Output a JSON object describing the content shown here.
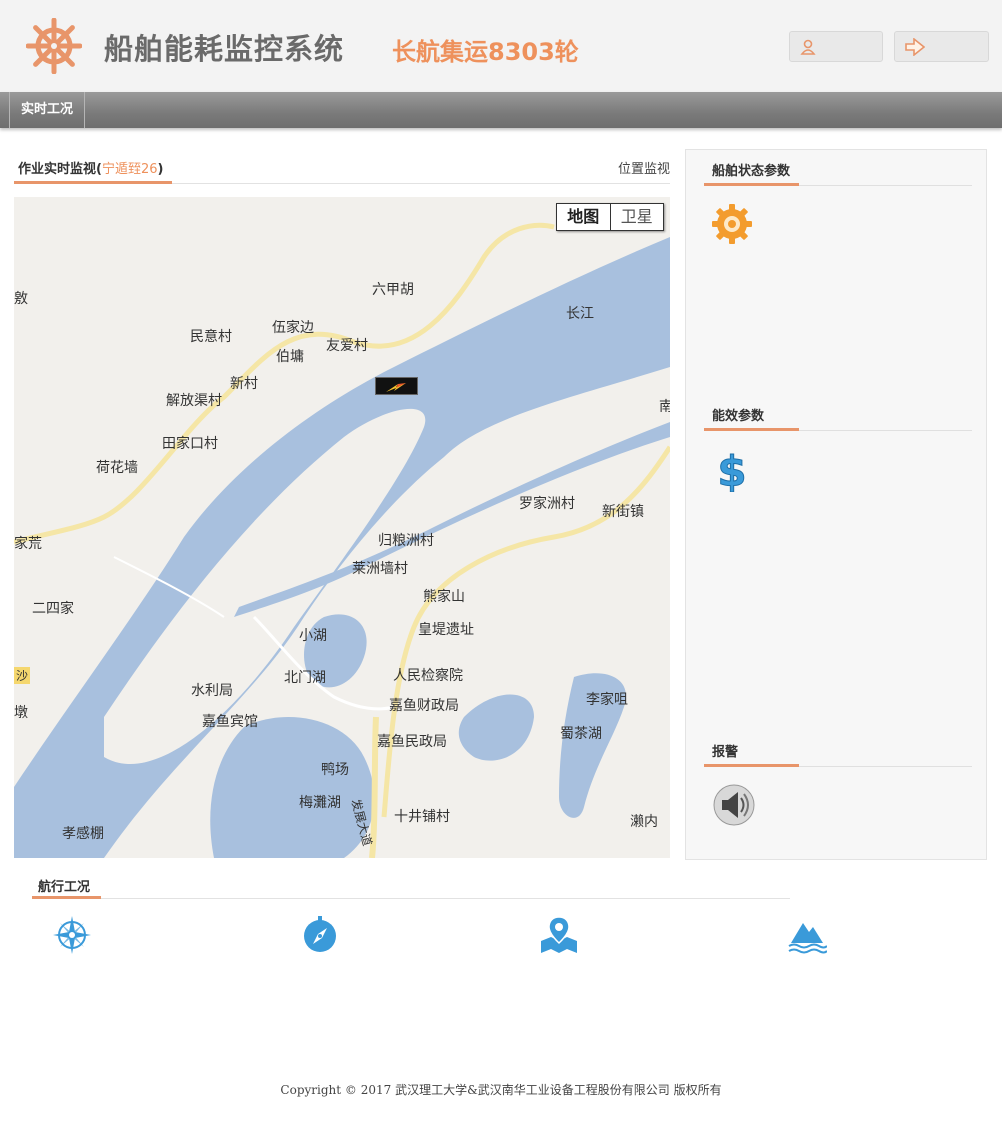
{
  "header": {
    "system_title": "船舶能耗监控系统",
    "ship_name": "长航集运8303轮",
    "logo_icon": "ship-wheel-icon",
    "user_button_icon": "user-icon",
    "logout_button_icon": "logout-arrow-icon",
    "accent_color": "#ee915c"
  },
  "nav": {
    "items": [
      {
        "label": "实时工况"
      }
    ]
  },
  "monitor": {
    "title": "作业实时监视",
    "paren_open": "(",
    "subtitle": "宁遁臸26",
    "paren_close": ")",
    "link": "位置监视"
  },
  "map": {
    "tabs": [
      {
        "label": "地图",
        "active": true
      },
      {
        "label": "卫星",
        "active": false
      }
    ],
    "places": [
      "六甲胡",
      "长江",
      "民意村",
      "伍家边",
      "伯墉",
      "友爱村",
      "新村",
      "解放渠村",
      "田家口村",
      "荷花墙",
      "罗家洲村",
      "新街镇",
      "归粮洲村",
      "莱洲墙村",
      "熊家山",
      "皇堤遗址",
      "小湖",
      "北门湖",
      "人民检察院",
      "水利局",
      "嘉鱼财政局",
      "嘉鱼宾馆",
      "嘉鱼民政局",
      "鸭场",
      "梅灘湖",
      "十井铺村",
      "孝感棚",
      "李家咀",
      "蜀茶湖",
      "濑内",
      "二四家",
      "家荒",
      "南",
      "敫",
      "墩",
      "沙",
      "发展大道"
    ]
  },
  "side": {
    "sections": [
      {
        "title": "船舶状态参数",
        "icon": "gear-icon"
      },
      {
        "title": "能效参数",
        "icon": "dollar-icon"
      },
      {
        "title": "报警",
        "icon": "speaker-icon"
      }
    ]
  },
  "voyage": {
    "title": "航行工况",
    "icons": [
      "compass-rose-icon",
      "compass-icon",
      "map-pin-icon",
      "waves-mountain-icon"
    ]
  },
  "footer": {
    "text": "Copyright © 2017 武汉理工大学&武汉南华工业设备工程股份有限公司  版权所有"
  }
}
